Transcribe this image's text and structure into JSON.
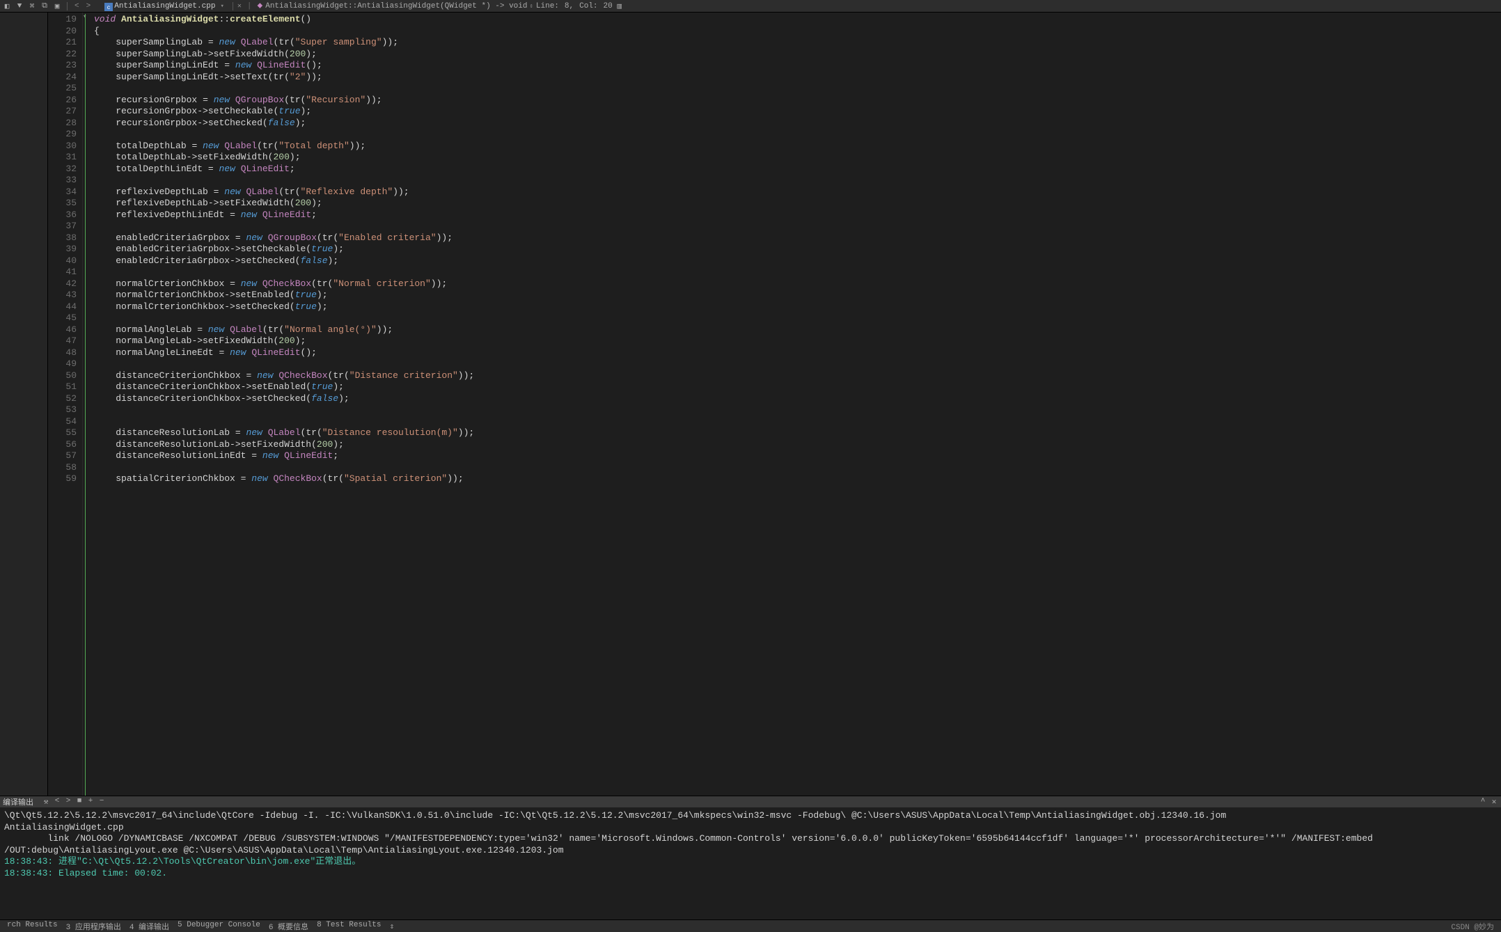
{
  "toolbar": {
    "tab1_name": "AntialiasingWidget.cpp",
    "breadcrumb": "AntialiasingWidget::AntialiasingWidget(QWidget *) -> void",
    "line_label": "Line:",
    "line_value": "8,",
    "col_label": "Col:",
    "col_value": "20"
  },
  "code_lines": [
    {
      "n": 19,
      "html": "<span class='kw'>void</span> <span class='cls'>AntialiasingWidget</span><span class='op'>::</span><span class='func'>createElement</span><span class='paren'>()</span>"
    },
    {
      "n": 20,
      "html": "<span class='paren'>{</span>"
    },
    {
      "n": 21,
      "html": "    <span class='ident'>superSamplingLab</span> <span class='op'>=</span> <span class='new'>new</span> <span class='qtype'>QLabel</span><span class='paren'>(</span><span class='ident'>tr</span><span class='paren'>(</span><span class='str'>\"Super sampling\"</span><span class='paren'>))</span>;"
    },
    {
      "n": 22,
      "html": "    <span class='ident'>superSamplingLab</span><span class='arrow'>-&gt;</span><span class='ident'>setFixedWidth</span><span class='paren'>(</span><span class='num'>200</span><span class='paren'>)</span>;"
    },
    {
      "n": 23,
      "html": "    <span class='ident'>superSamplingLinEdt</span> <span class='op'>=</span> <span class='new'>new</span> <span class='qtype'>QLineEdit</span><span class='paren'>()</span>;"
    },
    {
      "n": 24,
      "html": "    <span class='ident'>superSamplingLinEdt</span><span class='arrow'>-&gt;</span><span class='ident'>setText</span><span class='paren'>(</span><span class='ident'>tr</span><span class='paren'>(</span><span class='str'>\"2\"</span><span class='paren'>))</span>;"
    },
    {
      "n": 25,
      "html": ""
    },
    {
      "n": 26,
      "html": "    <span class='ident'>recursionGrpbox</span> <span class='op'>=</span> <span class='new'>new</span> <span class='qtype'>QGroupBox</span><span class='paren'>(</span><span class='ident'>tr</span><span class='paren'>(</span><span class='str'>\"Recursion\"</span><span class='paren'>))</span>;"
    },
    {
      "n": 27,
      "html": "    <span class='ident'>recursionGrpbox</span><span class='arrow'>-&gt;</span><span class='ident'>setCheckable</span><span class='paren'>(</span><span class='bool'>true</span><span class='paren'>)</span>;"
    },
    {
      "n": 28,
      "html": "    <span class='ident'>recursionGrpbox</span><span class='arrow'>-&gt;</span><span class='ident'>setChecked</span><span class='paren'>(</span><span class='bool'>false</span><span class='paren'>)</span>;"
    },
    {
      "n": 29,
      "html": ""
    },
    {
      "n": 30,
      "html": "    <span class='ident'>totalDepthLab</span> <span class='op'>=</span> <span class='new'>new</span> <span class='qtype'>QLabel</span><span class='paren'>(</span><span class='ident'>tr</span><span class='paren'>(</span><span class='str'>\"Total depth\"</span><span class='paren'>))</span>;"
    },
    {
      "n": 31,
      "html": "    <span class='ident'>totalDepthLab</span><span class='arrow'>-&gt;</span><span class='ident'>setFixedWidth</span><span class='paren'>(</span><span class='num'>200</span><span class='paren'>)</span>;"
    },
    {
      "n": 32,
      "html": "    <span class='ident'>totalDepthLinEdt</span> <span class='op'>=</span> <span class='new'>new</span> <span class='qtype'>QLineEdit</span>;"
    },
    {
      "n": 33,
      "html": ""
    },
    {
      "n": 34,
      "html": "    <span class='ident'>reflexiveDepthLab</span> <span class='op'>=</span> <span class='new'>new</span> <span class='qtype'>QLabel</span><span class='paren'>(</span><span class='ident'>tr</span><span class='paren'>(</span><span class='str'>\"Reflexive depth\"</span><span class='paren'>))</span>;"
    },
    {
      "n": 35,
      "html": "    <span class='ident'>reflexiveDepthLab</span><span class='arrow'>-&gt;</span><span class='ident'>setFixedWidth</span><span class='paren'>(</span><span class='num'>200</span><span class='paren'>)</span>;"
    },
    {
      "n": 36,
      "html": "    <span class='ident'>reflexiveDepthLinEdt</span> <span class='op'>=</span> <span class='new'>new</span> <span class='qtype'>QLineEdit</span>;"
    },
    {
      "n": 37,
      "html": ""
    },
    {
      "n": 38,
      "html": "    <span class='ident'>enabledCriteriaGrpbox</span> <span class='op'>=</span> <span class='new'>new</span> <span class='qtype'>QGroupBox</span><span class='paren'>(</span><span class='ident'>tr</span><span class='paren'>(</span><span class='str'>\"Enabled criteria\"</span><span class='paren'>))</span>;"
    },
    {
      "n": 39,
      "html": "    <span class='ident'>enabledCriteriaGrpbox</span><span class='arrow'>-&gt;</span><span class='ident'>setCheckable</span><span class='paren'>(</span><span class='bool'>true</span><span class='paren'>)</span>;"
    },
    {
      "n": 40,
      "html": "    <span class='ident'>enabledCriteriaGrpbox</span><span class='arrow'>-&gt;</span><span class='ident'>setChecked</span><span class='paren'>(</span><span class='bool'>false</span><span class='paren'>)</span>;"
    },
    {
      "n": 41,
      "html": ""
    },
    {
      "n": 42,
      "html": "    <span class='ident'>normalCrterionChkbox</span> <span class='op'>=</span> <span class='new'>new</span> <span class='qtype'>QCheckBox</span><span class='paren'>(</span><span class='ident'>tr</span><span class='paren'>(</span><span class='str'>\"Normal criterion\"</span><span class='paren'>))</span>;"
    },
    {
      "n": 43,
      "html": "    <span class='ident'>normalCrterionChkbox</span><span class='arrow'>-&gt;</span><span class='ident'>setEnabled</span><span class='paren'>(</span><span class='bool'>true</span><span class='paren'>)</span>;"
    },
    {
      "n": 44,
      "html": "    <span class='ident'>normalCrterionChkbox</span><span class='arrow'>-&gt;</span><span class='ident'>setChecked</span><span class='paren'>(</span><span class='bool'>true</span><span class='paren'>)</span>;"
    },
    {
      "n": 45,
      "html": ""
    },
    {
      "n": 46,
      "html": "    <span class='ident'>normalAngleLab</span> <span class='op'>=</span> <span class='new'>new</span> <span class='qtype'>QLabel</span><span class='paren'>(</span><span class='ident'>tr</span><span class='paren'>(</span><span class='str'>\"Normal angle(°)\"</span><span class='paren'>))</span>;"
    },
    {
      "n": 47,
      "html": "    <span class='ident'>normalAngleLab</span><span class='arrow'>-&gt;</span><span class='ident'>setFixedWidth</span><span class='paren'>(</span><span class='num'>200</span><span class='paren'>)</span>;"
    },
    {
      "n": 48,
      "html": "    <span class='ident'>normalAngleLineEdt</span> <span class='op'>=</span> <span class='new'>new</span> <span class='qtype'>QLineEdit</span><span class='paren'>()</span>;"
    },
    {
      "n": 49,
      "html": ""
    },
    {
      "n": 50,
      "html": "    <span class='ident'>distanceCriterionChkbox</span> <span class='op'>=</span> <span class='new'>new</span> <span class='qtype'>QCheckBox</span><span class='paren'>(</span><span class='ident'>tr</span><span class='paren'>(</span><span class='str'>\"Distance criterion\"</span><span class='paren'>))</span>;"
    },
    {
      "n": 51,
      "html": "    <span class='ident'>distanceCriterionChkbox</span><span class='arrow'>-&gt;</span><span class='ident'>setEnabled</span><span class='paren'>(</span><span class='bool'>true</span><span class='paren'>)</span>;"
    },
    {
      "n": 52,
      "html": "    <span class='ident'>distanceCriterionChkbox</span><span class='arrow'>-&gt;</span><span class='ident'>setChecked</span><span class='paren'>(</span><span class='bool'>false</span><span class='paren'>)</span>;"
    },
    {
      "n": 53,
      "html": ""
    },
    {
      "n": 54,
      "html": ""
    },
    {
      "n": 55,
      "html": "    <span class='ident'>distanceResolutionLab</span> <span class='op'>=</span> <span class='new'>new</span> <span class='qtype'>QLabel</span><span class='paren'>(</span><span class='ident'>tr</span><span class='paren'>(</span><span class='str'>\"Distance resoulution(m)\"</span><span class='paren'>))</span>;"
    },
    {
      "n": 56,
      "html": "    <span class='ident'>distanceResolutionLab</span><span class='arrow'>-&gt;</span><span class='ident'>setFixedWidth</span><span class='paren'>(</span><span class='num'>200</span><span class='paren'>)</span>;"
    },
    {
      "n": 57,
      "html": "    <span class='ident'>distanceResolutionLinEdt</span> <span class='op'>=</span> <span class='new'>new</span> <span class='qtype'>QLineEdit</span>;"
    },
    {
      "n": 58,
      "html": ""
    },
    {
      "n": 59,
      "html": "    <span class='ident'>spatialCriterionChkbox</span> <span class='op'>=</span> <span class='new'>new</span> <span class='qtype'>QCheckBox</span><span class='paren'>(</span><span class='ident'>tr</span><span class='paren'>(</span><span class='str'>\"Spatial criterion\"</span><span class='paren'>))</span>;"
    }
  ],
  "panel": {
    "title": "编译输出",
    "lines": [
      {
        "cls": "",
        "text": "\\Qt\\Qt5.12.2\\5.12.2\\msvc2017_64\\include\\QtCore -Idebug -I. -IC:\\VulkanSDK\\1.0.51.0\\include -IC:\\Qt\\Qt5.12.2\\5.12.2\\msvc2017_64\\mkspecs\\win32-msvc -Fodebug\\ @C:\\Users\\ASUS\\AppData\\Local\\Temp\\AntialiasingWidget.obj.12340.16.jom"
      },
      {
        "cls": "",
        "text": "AntialiasingWidget.cpp"
      },
      {
        "cls": "",
        "text": "        link /NOLOGO /DYNAMICBASE /NXCOMPAT /DEBUG /SUBSYSTEM:WINDOWS \"/MANIFESTDEPENDENCY:type='win32' name='Microsoft.Windows.Common-Controls' version='6.0.0.0' publicKeyToken='6595b64144ccf1df' language='*' processorArchitecture='*'\" /MANIFEST:embed /OUT:debug\\AntialiasingLyout.exe @C:\\Users\\ASUS\\AppData\\Local\\Temp\\AntialiasingLyout.exe.12340.1203.jom"
      },
      {
        "cls": "out-green",
        "text": "18:38:43: 进程\"C:\\Qt\\Qt5.12.2\\Tools\\QtCreator\\bin\\jom.exe\"正常退出。"
      },
      {
        "cls": "out-green",
        "text": "18:38:43: Elapsed time: 00:02."
      }
    ]
  },
  "status": {
    "items": [
      "rch Results",
      "3  应用程序输出",
      "4  编译输出",
      "5  Debugger Console",
      "6  概要信息",
      "8  Test Results"
    ],
    "watermark": "CSDN @妙为"
  }
}
